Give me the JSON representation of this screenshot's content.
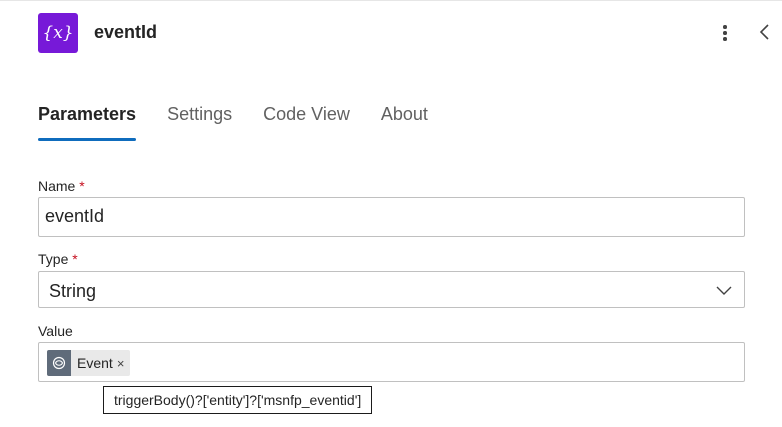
{
  "header": {
    "icon_glyph": "{x}",
    "icon_color": "#7719d8",
    "title": "eventId"
  },
  "tabs": [
    {
      "label": "Parameters",
      "active": true
    },
    {
      "label": "Settings",
      "active": false
    },
    {
      "label": "Code View",
      "active": false
    },
    {
      "label": "About",
      "active": false
    }
  ],
  "form": {
    "name": {
      "label": "Name",
      "required_mark": "*",
      "value": "eventId"
    },
    "type": {
      "label": "Type",
      "required_mark": "*",
      "value": "String"
    },
    "value": {
      "label": "Value",
      "token": {
        "label": "Event",
        "remove": "×",
        "icon": "dataverse-icon"
      }
    }
  },
  "tooltip": {
    "text": "triggerBody()?['entity']?['msnfp_eventid']"
  },
  "colors": {
    "accent": "#0f6cbd",
    "required": "#c50f1f",
    "icon_bg": "#7719d8",
    "token_icon_bg": "#5f6b7a"
  }
}
